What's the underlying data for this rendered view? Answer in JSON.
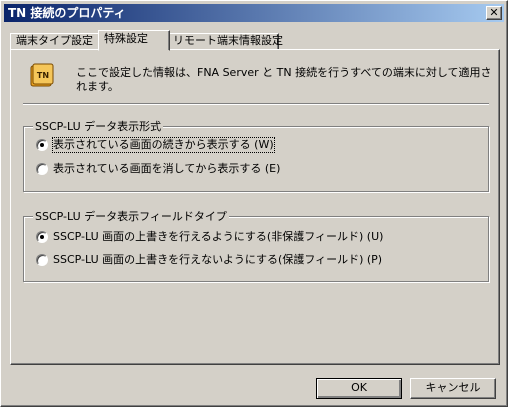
{
  "window": {
    "title": "TN 接続のプロパティ",
    "close_glyph": "✕"
  },
  "tabs": [
    {
      "label": "端末タイプ設定",
      "active": false
    },
    {
      "label": "特殊設定",
      "active": true
    },
    {
      "label": "リモート端末情報設定",
      "active": false
    }
  ],
  "panel": {
    "icon": "tn-terminal-icon",
    "info_text": "ここで設定した情報は、FNA Server と TN 接続を行うすべての端末に対して適用されます。",
    "group_display": {
      "label": "SSCP-LU データ表示形式",
      "options": [
        {
          "label": "表示されている画面の続きから表示する (W)",
          "checked": true
        },
        {
          "label": "表示されている画面を消してから表示する (E)",
          "checked": false
        }
      ]
    },
    "group_field": {
      "label": "SSCP-LU データ表示フィールドタイプ",
      "options": [
        {
          "label": "SSCP-LU 画面の上書きを行えるようにする(非保護フィールド) (U)",
          "checked": true
        },
        {
          "label": "SSCP-LU 画面の上書きを行えないようにする(保護フィールド) (P)",
          "checked": false
        }
      ]
    }
  },
  "buttons": {
    "ok_label": "OK",
    "cancel_label": "キャンセル"
  },
  "colors": {
    "titlebar_start": "#0a246a",
    "titlebar_end": "#a6caf0",
    "face": "#d4d0c8",
    "icon_accent": "#e8a020"
  }
}
